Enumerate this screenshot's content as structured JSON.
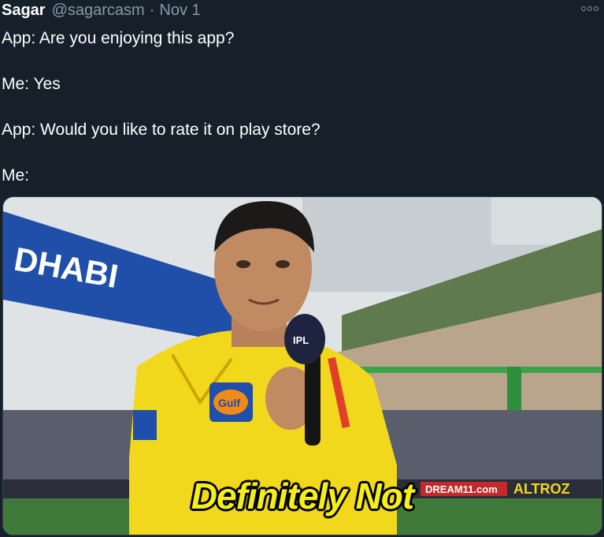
{
  "tweet": {
    "author_name": "Sagar",
    "author_handle": "@sagarcasm",
    "separator": "·",
    "date": "Nov 1",
    "more_icon": "more-horizontal-icon",
    "lines": [
      "App: Are you enjoying this app?",
      "Me: Yes",
      "App: Would you like to rate it on play store?",
      "Me:"
    ]
  },
  "media": {
    "caption": "Definitely Not",
    "banner_text": "DHABI",
    "mic_logo": "IPL",
    "shirt_sponsor": "Gulf",
    "ad_boards": [
      "DREAM11.com",
      "ALTROZ"
    ],
    "colors": {
      "jersey": "#f2d81c",
      "banner": "#1f4fa8",
      "caption": "#f4ee1a",
      "background": "#15202b",
      "muted": "#8899a6"
    }
  }
}
